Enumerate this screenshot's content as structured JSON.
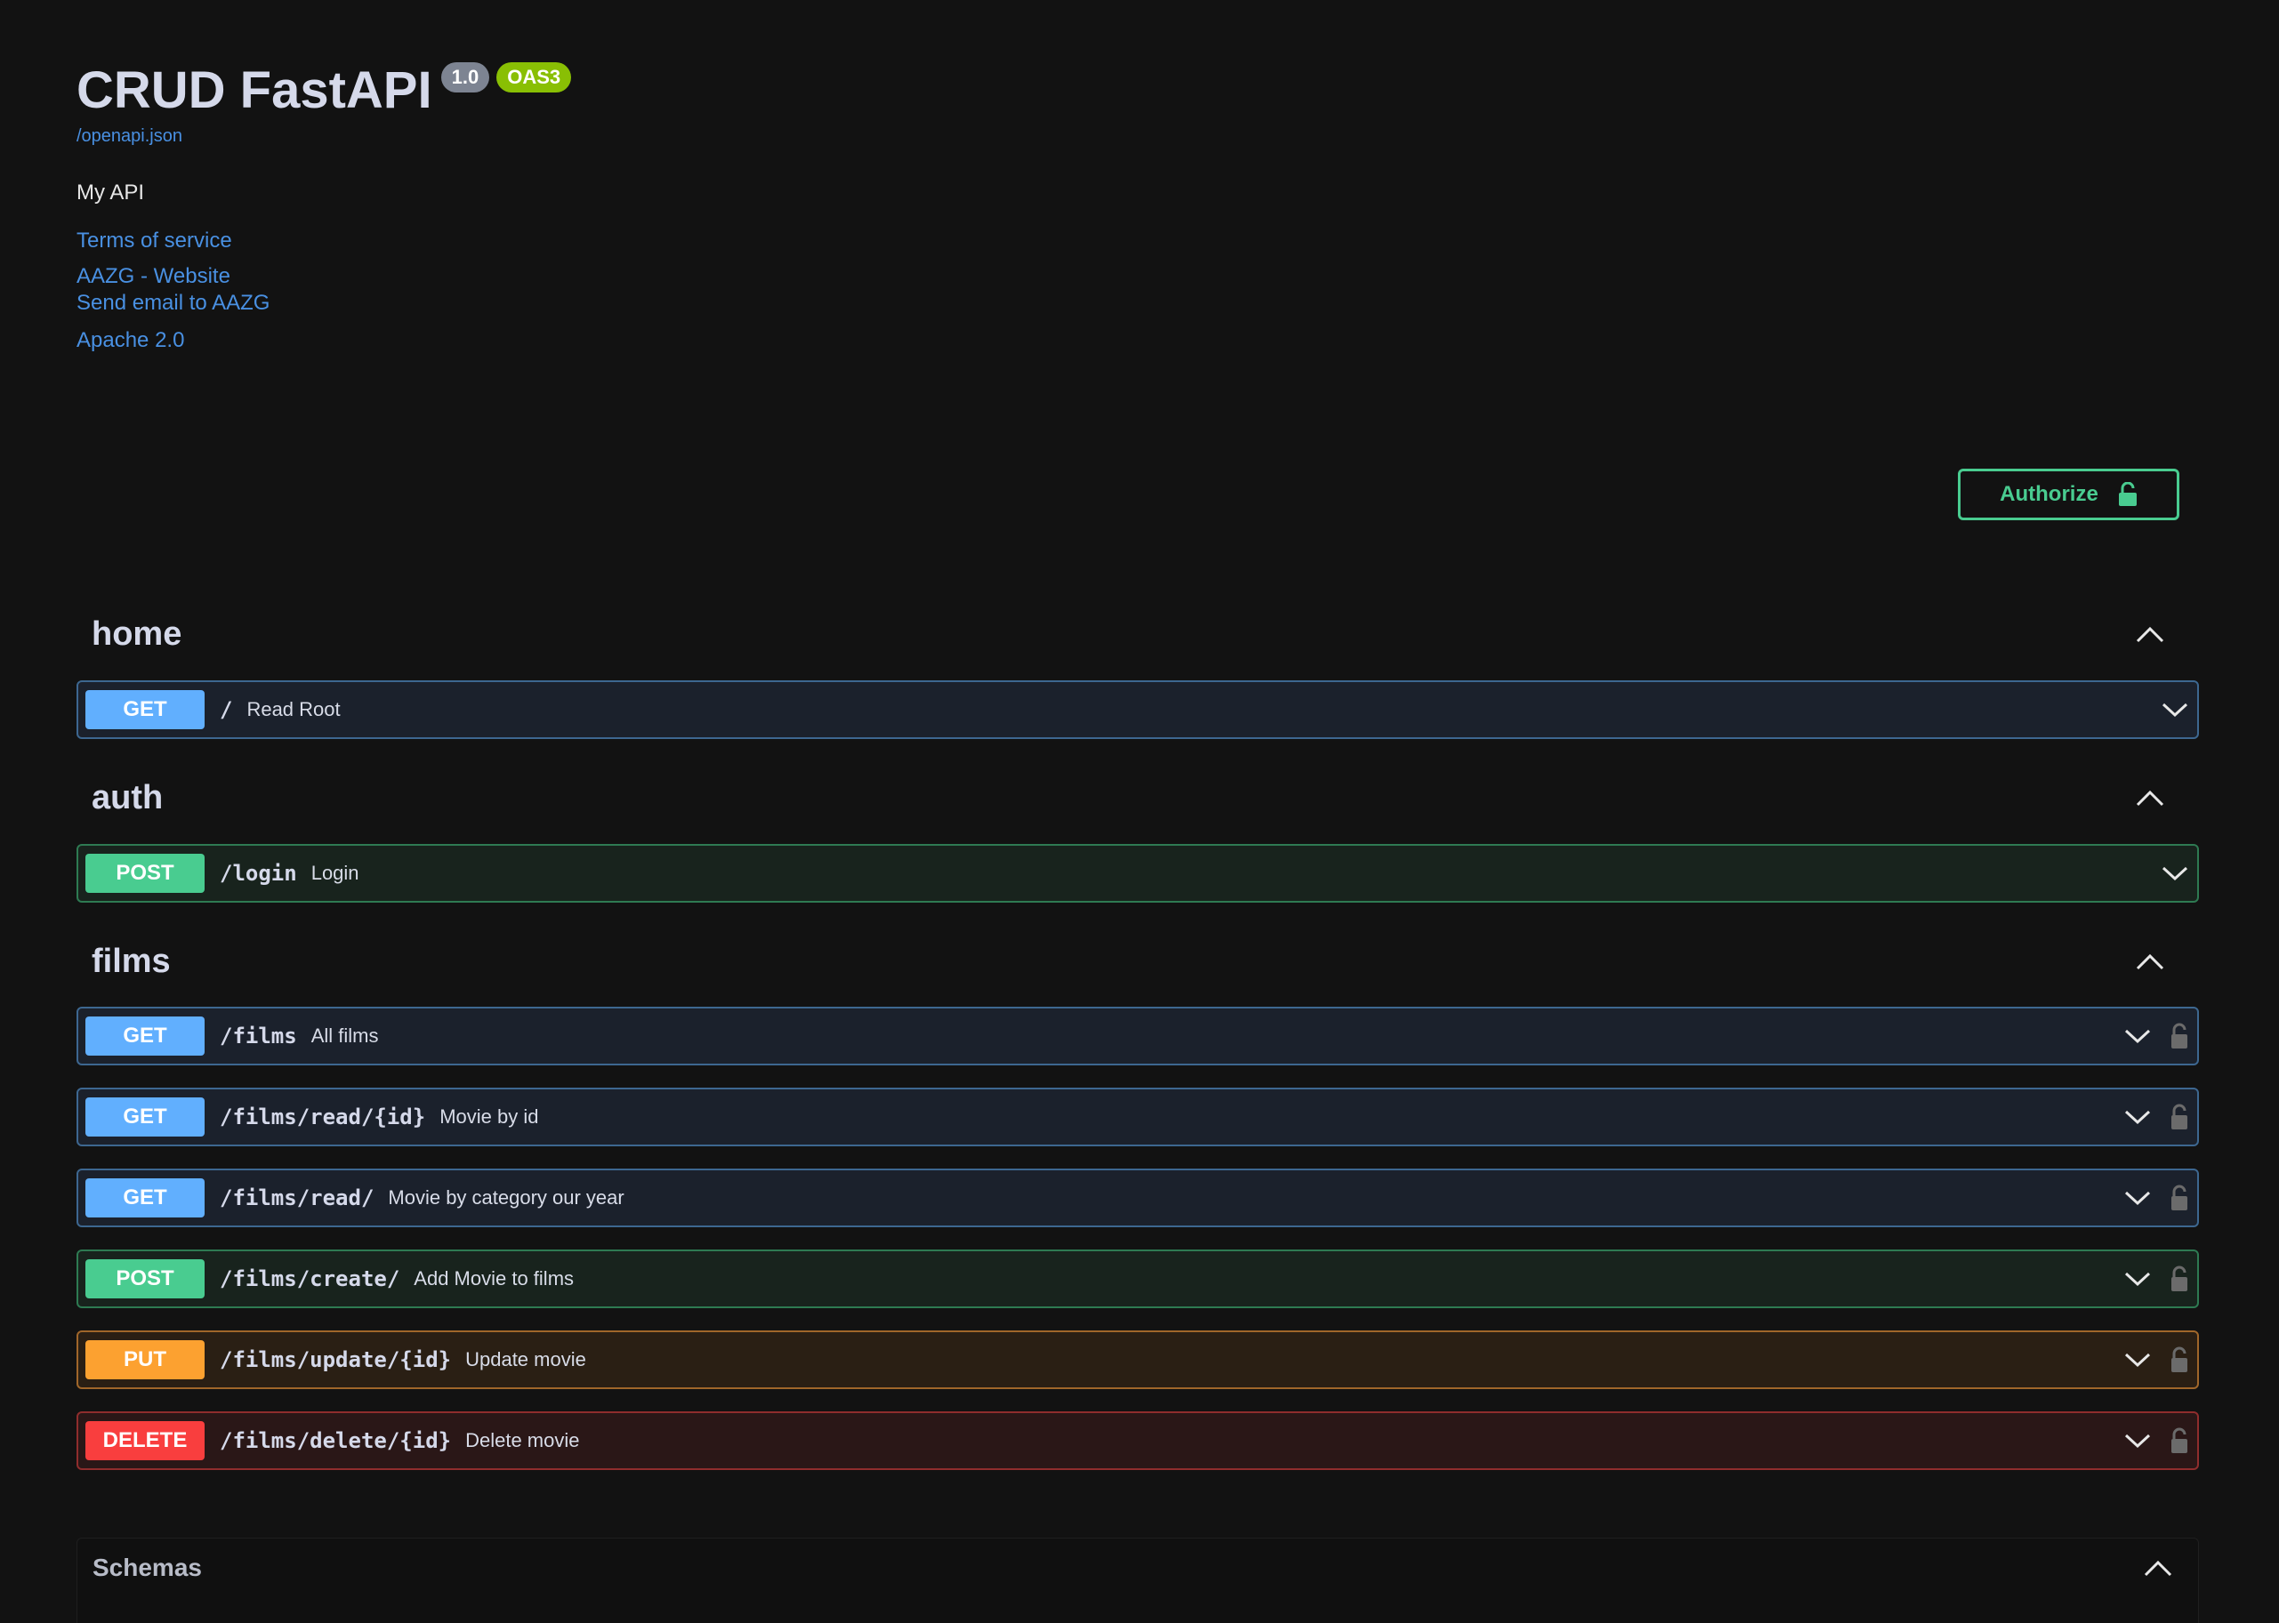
{
  "info": {
    "title": "CRUD FastAPI",
    "version": "1.0",
    "oas": "OAS3",
    "spec_link": "/openapi.json",
    "description": "My API",
    "terms": "Terms of service",
    "contact_website": "AAZG - Website",
    "contact_email": "Send email to AAZG",
    "license": "Apache 2.0"
  },
  "authorize": {
    "label": "Authorize",
    "icon": "unlocked-lock-icon"
  },
  "colors": {
    "get": "#61affe",
    "post": "#49cc90",
    "put": "#fca130",
    "delete": "#f93e3e",
    "background": "#121212",
    "link": "#4990e2"
  },
  "sections": [
    {
      "name": "home",
      "operations": [
        {
          "method": "GET",
          "path": "/",
          "summary": "Read Root",
          "locked": false
        }
      ]
    },
    {
      "name": "auth",
      "operations": [
        {
          "method": "POST",
          "path": "/login",
          "summary": "Login",
          "locked": false
        }
      ]
    },
    {
      "name": "films",
      "operations": [
        {
          "method": "GET",
          "path": "/films",
          "summary": "All films",
          "locked": true
        },
        {
          "method": "GET",
          "path": "/films/read/{id}",
          "summary": "Movie by id",
          "locked": true
        },
        {
          "method": "GET",
          "path": "/films/read/",
          "summary": "Movie by category our year",
          "locked": true
        },
        {
          "method": "POST",
          "path": "/films/create/",
          "summary": "Add Movie to films",
          "locked": true
        },
        {
          "method": "PUT",
          "path": "/films/update/{id}",
          "summary": "Update movie",
          "locked": true
        },
        {
          "method": "DELETE",
          "path": "/films/delete/{id}",
          "summary": "Delete movie",
          "locked": true
        }
      ]
    }
  ],
  "schemas": {
    "title": "Schemas"
  }
}
